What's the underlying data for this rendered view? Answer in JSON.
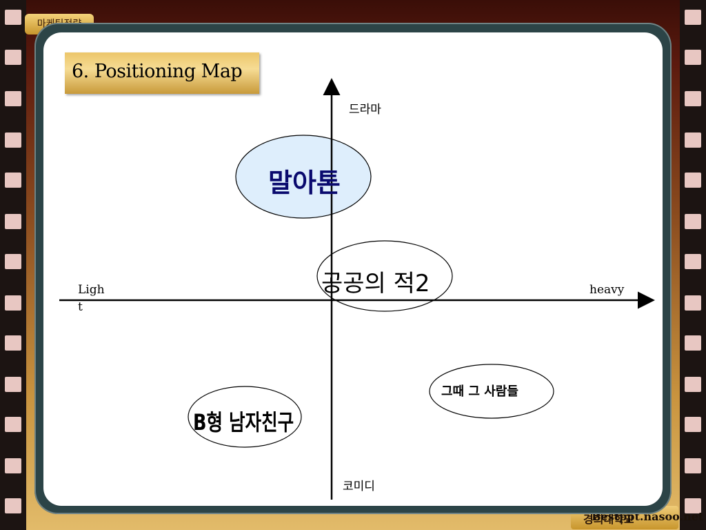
{
  "header": {
    "section_tab": "마케팅전략",
    "title": "6. Positioning Map"
  },
  "footer": {
    "page_text": "경희대학교",
    "url": "Bestppt.nasoo.net"
  },
  "diagram": {
    "axis_top": "드라마",
    "axis_bottom": "코미디",
    "axis_left_line1": "Ligh",
    "axis_left_line2": "t",
    "axis_right": "heavy",
    "items": {
      "malaton": "말아톤",
      "public_enemy": "공공의 적2",
      "then_people": "그때 그 사람들",
      "b_boyfriend": "B형 남자친구"
    },
    "colors": {
      "highlight_fill": "#deeefc",
      "label_navy": "#0a0a6e"
    }
  }
}
